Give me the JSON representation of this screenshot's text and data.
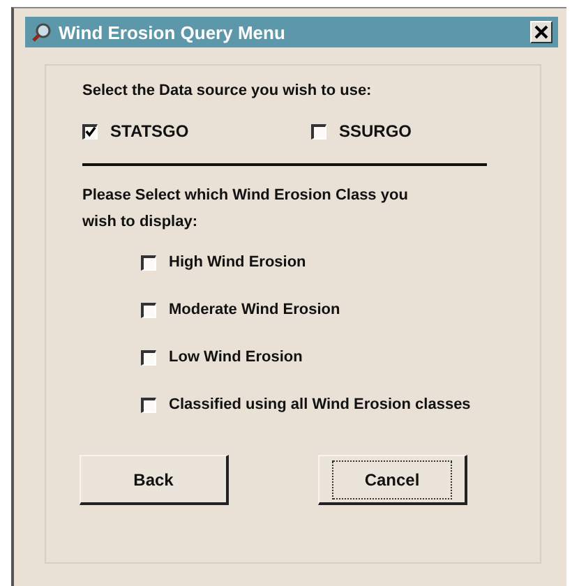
{
  "window": {
    "title": "Wind Erosion Query Menu"
  },
  "source_prompt": "Select the Data source you wish to use:",
  "sources": [
    {
      "label": "STATSGO",
      "checked": true
    },
    {
      "label": "SSURGO",
      "checked": false
    }
  ],
  "class_prompt": "Please Select which Wind Erosion Class you wish to display:",
  "classes": [
    {
      "label": "High Wind Erosion",
      "checked": false
    },
    {
      "label": "Moderate Wind Erosion",
      "checked": false
    },
    {
      "label": "Low Wind Erosion",
      "checked": false
    },
    {
      "label": "Classified using all Wind Erosion classes",
      "checked": false
    }
  ],
  "buttons": [
    {
      "label": "Back",
      "focused": false
    },
    {
      "label": "Cancel",
      "focused": true
    }
  ]
}
